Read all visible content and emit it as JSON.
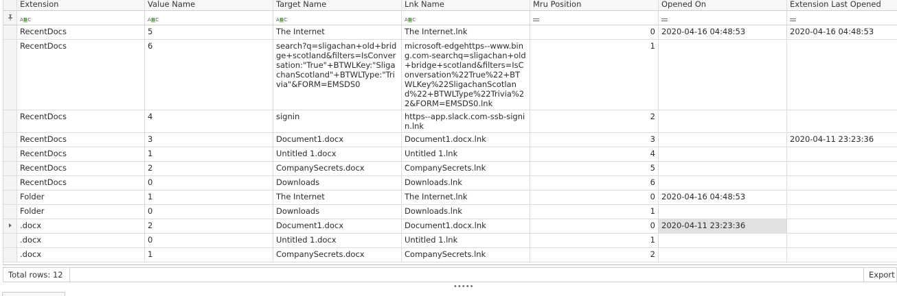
{
  "columns": [
    "Extension",
    "Value Name",
    "Target Name",
    "Lnk Name",
    "Mru Position",
    "Opened On",
    "Extension Last Opened"
  ],
  "filter_icons": [
    "text-filter",
    "text-filter",
    "text-filter",
    "text-filter",
    "equals-filter",
    "equals-filter",
    "equals-filter"
  ],
  "rows": [
    {
      "height": 21,
      "cells": [
        "RecentDocs",
        "5",
        "The Internet",
        "The Internet.lnk",
        "0",
        "2020-04-16 04:48:53",
        "2020-04-16 04:48:53"
      ]
    },
    {
      "height": 103,
      "cells": [
        "RecentDocs",
        "6",
        "search?q=sligachan+old+bridge+scotland&filters=IsConversation:\"True\"+BTWLKey:\"SligachanScotland\"+BTWLType:\"Trivia\"&FORM=EMSDS0",
        "microsoft-edgehttps--www.bing.com-searchq=sligachan+old+bridge+scotland&filters=IsConversation%22True%22+BTWLKey%22SligachanScotland%22+BTWLType%22Trivia%22&FORM=EMSDS0.lnk",
        "1",
        "",
        ""
      ]
    },
    {
      "height": 33,
      "cells": [
        "RecentDocs",
        "4",
        "signin",
        "https--app.slack.com-ssb-signin.lnk",
        "2",
        "",
        ""
      ]
    },
    {
      "height": 21,
      "cells": [
        "RecentDocs",
        "3",
        "Document1.docx",
        "Document1.docx.lnk",
        "3",
        "",
        "2020-04-11 23:23:36"
      ]
    },
    {
      "height": 21,
      "cells": [
        "RecentDocs",
        "1",
        "Untitled 1.docx",
        "Untitled 1.lnk",
        "4",
        "",
        ""
      ]
    },
    {
      "height": 21,
      "cells": [
        "RecentDocs",
        "2",
        "CompanySecrets.docx",
        "CompanySecrets.lnk",
        "5",
        "",
        ""
      ]
    },
    {
      "height": 21,
      "cells": [
        "RecentDocs",
        "0",
        "Downloads",
        "Downloads.lnk",
        "6",
        "",
        ""
      ]
    },
    {
      "height": 21,
      "cells": [
        "Folder",
        "1",
        "The Internet",
        "The Internet.lnk",
        "0",
        "2020-04-16 04:48:53",
        ""
      ]
    },
    {
      "height": 21,
      "cells": [
        "Folder",
        "0",
        "Downloads",
        "Downloads.lnk",
        "1",
        "",
        ""
      ]
    },
    {
      "height": 21,
      "cells": [
        ".docx",
        "2",
        "Document1.docx",
        "Document1.docx.lnk",
        "0",
        "2020-04-11 23:23:36",
        ""
      ],
      "selected": true,
      "focused_col": 5
    },
    {
      "height": 21,
      "cells": [
        ".docx",
        "0",
        "Untitled 1.docx",
        "Untitled 1.lnk",
        "1",
        "",
        ""
      ]
    },
    {
      "height": 21,
      "cells": [
        ".docx",
        "1",
        "CompanySecrets.docx",
        "CompanySecrets.lnk",
        "2",
        "",
        ""
      ]
    }
  ],
  "status": {
    "total_rows": "Total rows: 12",
    "export_label": "Export"
  }
}
